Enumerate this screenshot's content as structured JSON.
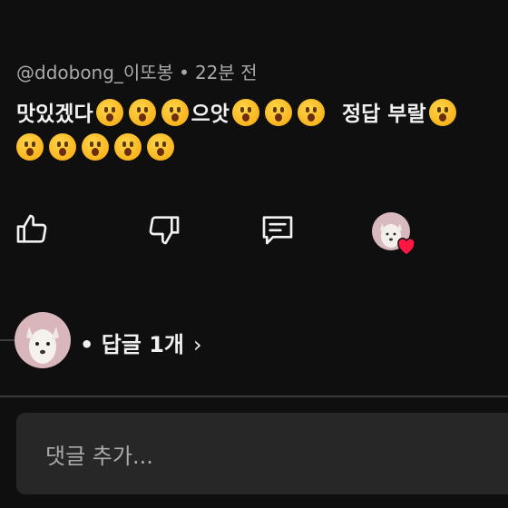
{
  "comment": {
    "author": "@ddobong_이또봉",
    "separator": "•",
    "time": "22분 전",
    "text_segments": [
      "맛있겠다",
      "으앗",
      "정답 부랄"
    ],
    "emoji": "astonished-face"
  },
  "actions": {
    "like_icon": "thumb-up-icon",
    "dislike_icon": "thumb-down-icon",
    "reply_icon": "reply-comment-icon",
    "creator_heart_icon": "heart-icon"
  },
  "replies": {
    "bullet": "•",
    "label": "답글 1개",
    "chevron": "›"
  },
  "add_comment": {
    "placeholder": "댓글 추가..."
  },
  "colors": {
    "background": "#0f0f0f",
    "secondary_text": "#aaaaaa",
    "heart": "#ff1744",
    "input_bg": "#272727"
  }
}
